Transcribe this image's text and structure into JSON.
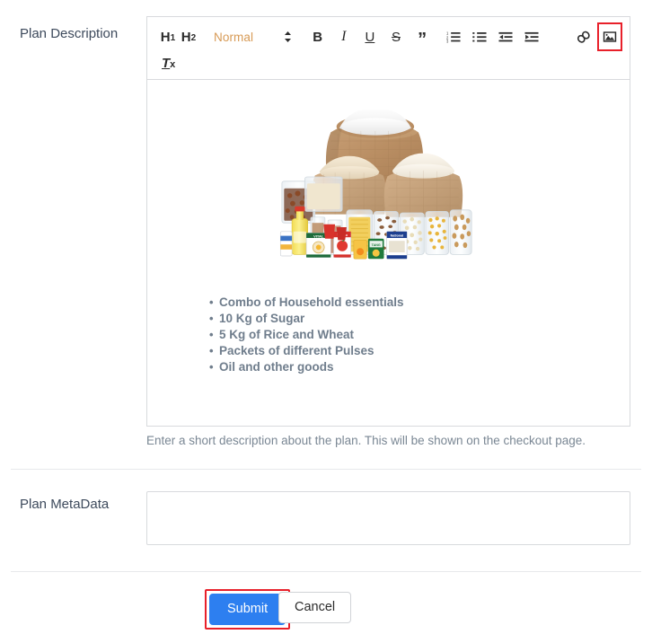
{
  "form": {
    "description_label": "Plan Description",
    "metadata_label": "Plan MetaData",
    "description_helper": "Enter a short description about the plan. This will be shown on the checkout page.",
    "metadata_value": "",
    "metadata_placeholder": ""
  },
  "toolbar": {
    "h1_label": "H",
    "h1_sub": "1",
    "h2_label": "H",
    "h2_sub": "2",
    "format_picker_value": "Normal",
    "bold_label": "B",
    "italic_label": "I",
    "underline_label": "U",
    "strike_label": "S",
    "blockquote_label": "”",
    "clear_format_label": "T",
    "clear_format_sub": "x",
    "icons": {
      "ordered_list": "ordered-list-icon",
      "bullet_list": "bullet-list-icon",
      "outdent": "outdent-icon",
      "indent": "indent-icon",
      "link": "link-icon",
      "image": "image-icon",
      "chevron": "chevron-updown-icon"
    },
    "highlighted_button": "image-icon"
  },
  "editor_content": {
    "image_alt": "grocery-household-essentials-photo",
    "bullets": [
      "Combo of Household essentials",
      "10 Kg of Sugar",
      "5 Kg of Rice and Wheat",
      "Packets of different Pulses",
      "Oil and other goods"
    ]
  },
  "footer": {
    "submit_label": "Submit",
    "cancel_label": "Cancel"
  },
  "colors": {
    "accent_blue": "#2d7ff0",
    "highlight_red": "#e8202a",
    "picker_orange": "#d79a55",
    "label_slate": "#3d4a5c",
    "bullet_gray": "#6f7d8c",
    "border_gray": "#d8dadd"
  }
}
